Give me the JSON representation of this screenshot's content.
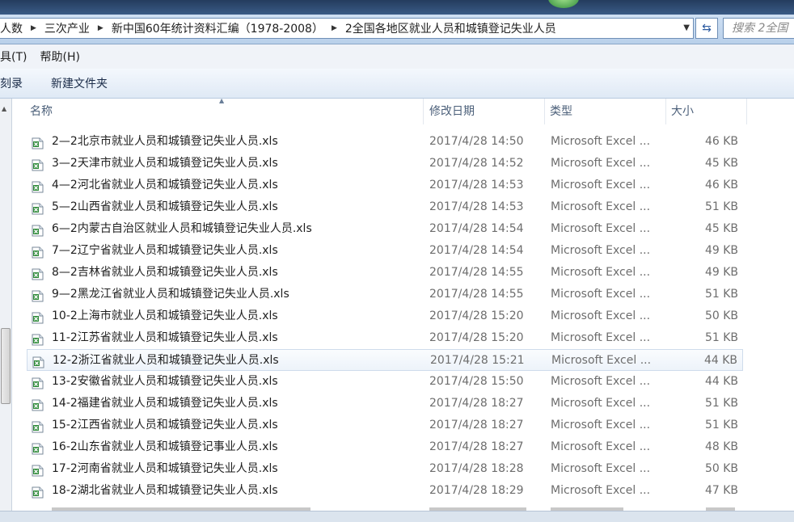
{
  "breadcrumb": [
    "人数",
    "三次产业",
    "新中国60年统计资料汇编（1978-2008）",
    "2全国各地区就业人员和城镇登记失业人员"
  ],
  "search": {
    "placeholder": "搜索 2全国"
  },
  "menu": [
    "具(T)",
    "帮助(H)"
  ],
  "commands": [
    "刻录",
    "新建文件夹"
  ],
  "columns": {
    "name": "名称",
    "date": "修改日期",
    "type": "类型",
    "size": "大小"
  },
  "files": [
    {
      "name": "2—2北京市就业人员和城镇登记失业人员.xls",
      "date": "2017/4/28 14:50",
      "type": "Microsoft Excel ...",
      "size": "46 KB"
    },
    {
      "name": "3—2天津市就业人员和城镇登记失业人员.xls",
      "date": "2017/4/28 14:52",
      "type": "Microsoft Excel ...",
      "size": "45 KB"
    },
    {
      "name": "4—2河北省就业人员和城镇登记失业人员.xls",
      "date": "2017/4/28 14:53",
      "type": "Microsoft Excel ...",
      "size": "46 KB"
    },
    {
      "name": "5—2山西省就业人员和城镇登记失业人员.xls",
      "date": "2017/4/28 14:53",
      "type": "Microsoft Excel ...",
      "size": "51 KB"
    },
    {
      "name": "6—2内蒙古自治区就业人员和城镇登记失业人员.xls",
      "date": "2017/4/28 14:54",
      "type": "Microsoft Excel ...",
      "size": "45 KB"
    },
    {
      "name": "7—2辽宁省就业人员和城镇登记失业人员.xls",
      "date": "2017/4/28 14:54",
      "type": "Microsoft Excel ...",
      "size": "49 KB"
    },
    {
      "name": "8—2吉林省就业人员和城镇登记失业人员.xls",
      "date": "2017/4/28 14:55",
      "type": "Microsoft Excel ...",
      "size": "49 KB"
    },
    {
      "name": "9—2黑龙江省就业人员和城镇登记失业人员.xls",
      "date": "2017/4/28 14:55",
      "type": "Microsoft Excel ...",
      "size": "51 KB"
    },
    {
      "name": "10-2上海市就业人员和城镇登记失业人员.xls",
      "date": "2017/4/28 15:20",
      "type": "Microsoft Excel ...",
      "size": "50 KB"
    },
    {
      "name": "11-2江苏省就业人员和城镇登记失业人员.xls",
      "date": "2017/4/28 15:20",
      "type": "Microsoft Excel ...",
      "size": "51 KB"
    },
    {
      "name": "12-2浙江省就业人员和城镇登记失业人员.xls",
      "date": "2017/4/28 15:21",
      "type": "Microsoft Excel ...",
      "size": "44 KB"
    },
    {
      "name": "13-2安徽省就业人员和城镇登记失业人员.xls",
      "date": "2017/4/28 15:50",
      "type": "Microsoft Excel ...",
      "size": "44 KB"
    },
    {
      "name": "14-2福建省就业人员和城镇登记失业人员.xls",
      "date": "2017/4/28 18:27",
      "type": "Microsoft Excel ...",
      "size": "51 KB"
    },
    {
      "name": "15-2江西省就业人员和城镇登记失业人员.xls",
      "date": "2017/4/28 18:27",
      "type": "Microsoft Excel ...",
      "size": "51 KB"
    },
    {
      "name": "16-2山东省就业人员和城镇登记事业人员.xls",
      "date": "2017/4/28 18:27",
      "type": "Microsoft Excel ...",
      "size": "48 KB"
    },
    {
      "name": "17-2河南省就业人员和城镇登记失业人员.xls",
      "date": "2017/4/28 18:28",
      "type": "Microsoft Excel ...",
      "size": "50 KB"
    },
    {
      "name": "18-2湖北省就业人员和城镇登记失业人员.xls",
      "date": "2017/4/28 18:29",
      "type": "Microsoft Excel ...",
      "size": "47 KB"
    }
  ],
  "selected_index": 10,
  "colors": {
    "accent": "#2c5aa0",
    "excel_green": "#2f8a3a",
    "selection": "#edf3fa"
  }
}
